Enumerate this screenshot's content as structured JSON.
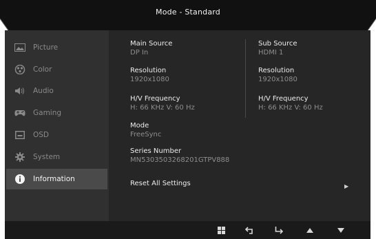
{
  "osd": {
    "title": "Mode - Standard",
    "menu": [
      {
        "label": "Picture",
        "icon": "picture-icon"
      },
      {
        "label": "Color",
        "icon": "color-palette-icon"
      },
      {
        "label": "Audio",
        "icon": "speaker-icon"
      },
      {
        "label": "Gaming",
        "icon": "gamepad-icon"
      },
      {
        "label": "OSD",
        "icon": "osd-icon"
      },
      {
        "label": "System",
        "icon": "gear-icon"
      },
      {
        "label": "Information",
        "icon": "info-icon"
      }
    ],
    "info": {
      "main_source_label": "Main Source",
      "main_source_value": "DP In",
      "sub_source_label": "Sub Source",
      "sub_source_value": "HDMI 1",
      "main_resolution_label": "Resolution",
      "main_resolution_value": "1920x1080",
      "sub_resolution_label": "Resolution",
      "sub_resolution_value": "1920x1080",
      "main_freq_label": "H/V Frequency",
      "main_freq_value": "H: 66 KHz V: 60 Hz",
      "sub_freq_label": "H/V Frequency",
      "sub_freq_value": "H: 66 KHz V: 60 Hz",
      "mode_label": "Mode",
      "mode_value": "FreeSync",
      "serial_label": "Series Number",
      "serial_value": "MN5303503268201GTPV888",
      "reset_label": "Reset All Settings"
    },
    "nav_buttons": [
      "menu-grid-icon",
      "back-icon",
      "enter-icon",
      "up-icon",
      "down-icon"
    ],
    "colors": {
      "background": "#262626",
      "sidebar": "#303030",
      "active": "#4a4a4a",
      "title_bar": "#111111"
    }
  }
}
